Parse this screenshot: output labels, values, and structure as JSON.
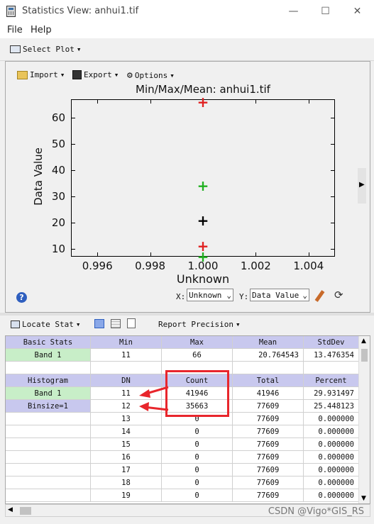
{
  "window": {
    "title": "Statistics View: anhui1.tif",
    "minimize": "—",
    "maximize": "☐",
    "close": "✕"
  },
  "menu": {
    "file": "File",
    "help": "Help"
  },
  "toolbar1": {
    "select_plot": "Select Plot"
  },
  "plot_toolbar": {
    "import": "Import",
    "export": "Export",
    "options": "Options"
  },
  "chart_data": {
    "type": "scatter",
    "title": "Min/Max/Mean: anhui1.tif",
    "xlabel": "Unknown",
    "ylabel": "Data Value",
    "xlim": [
      0.995,
      1.005
    ],
    "ylim": [
      7,
      67
    ],
    "xticks": [
      "0.996",
      "0.998",
      "1.000",
      "1.002",
      "1.004"
    ],
    "yticks": [
      "10",
      "20",
      "30",
      "40",
      "50",
      "60"
    ],
    "series": [
      {
        "color": "#e02020",
        "points": [
          {
            "x": 1.0,
            "y": 66
          },
          {
            "x": 1.0,
            "y": 11
          }
        ]
      },
      {
        "color": "#20b020",
        "points": [
          {
            "x": 1.0,
            "y": 34
          },
          {
            "x": 1.0,
            "y": 7
          }
        ]
      },
      {
        "color": "#000000",
        "points": [
          {
            "x": 1.0,
            "y": 20.76
          }
        ]
      }
    ]
  },
  "axis_select": {
    "x_label": "X:",
    "x_value": "Unknown",
    "y_label": "Y:",
    "y_value": "Data Value"
  },
  "toolbar2": {
    "locate_stat": "Locate Stat",
    "report_precision": "Report Precision"
  },
  "basic": {
    "headers": [
      "Basic Stats",
      "Min",
      "Max",
      "Mean",
      "StdDev"
    ],
    "row": [
      "Band 1",
      "11",
      "66",
      "20.764543",
      "13.476354"
    ]
  },
  "hist": {
    "headers": [
      "Histogram",
      "DN",
      "Count",
      "Total",
      "Percent"
    ],
    "labels": [
      "Band 1",
      "Binsize=1",
      "",
      "",
      "",
      "",
      "",
      "",
      ""
    ],
    "rows": [
      [
        "11",
        "41946",
        "41946",
        "29.931497"
      ],
      [
        "12",
        "35663",
        "77609",
        "25.448123"
      ],
      [
        "13",
        "0",
        "77609",
        "0.000000"
      ],
      [
        "14",
        "0",
        "77609",
        "0.000000"
      ],
      [
        "15",
        "0",
        "77609",
        "0.000000"
      ],
      [
        "16",
        "0",
        "77609",
        "0.000000"
      ],
      [
        "17",
        "0",
        "77609",
        "0.000000"
      ],
      [
        "18",
        "0",
        "77609",
        "0.000000"
      ],
      [
        "19",
        "0",
        "77609",
        "0.000000"
      ]
    ]
  },
  "watermark": "CSDN @Vigo*GIS_RS"
}
